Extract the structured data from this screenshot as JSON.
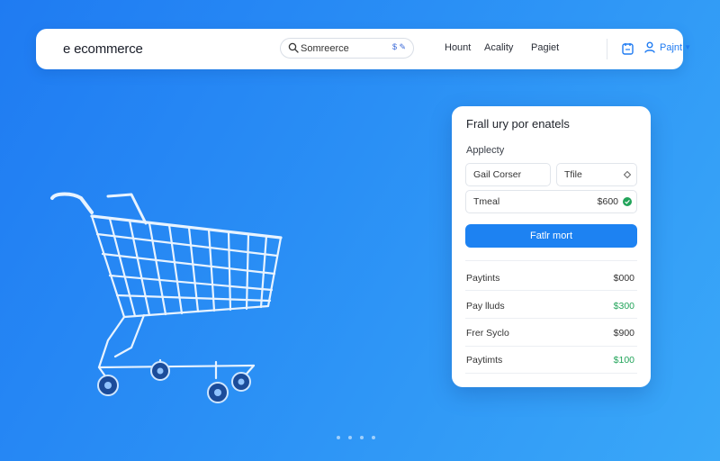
{
  "header": {
    "logo": "e ecommerce",
    "search": {
      "placeholder": "Somreerce",
      "extra": "$ ✎"
    },
    "nav": [
      "Hount",
      "Acality",
      "Pagiet"
    ],
    "user_label": "Pajnt",
    "icons": {
      "search": "search-icon",
      "cart": "cart-icon",
      "user": "user-icon",
      "caret": "chevron-down-icon"
    }
  },
  "panel": {
    "title": "Frall ury por enatels",
    "section_label": "Applecty",
    "field_left": "Gail Corser",
    "field_right": "Tfile",
    "total_label": "Tmeal",
    "total_value": "$600",
    "button": "Fatlr mort",
    "lines": [
      {
        "label": "Paytints",
        "value": "$000",
        "color": "#333333"
      },
      {
        "label": "Pay lluds",
        "value": "$300",
        "color": "#22a45a"
      },
      {
        "label": "Frer Syclo",
        "value": "$900",
        "color": "#333333"
      },
      {
        "label": "Paytimts",
        "value": "$100",
        "color": "#22a45a"
      }
    ]
  },
  "carousel": {
    "dot_count": 4
  },
  "colors": {
    "accent": "#1d82f2",
    "success": "#22a45a",
    "bg_start": "#1f7bf2",
    "bg_end": "#3aa8f8"
  }
}
